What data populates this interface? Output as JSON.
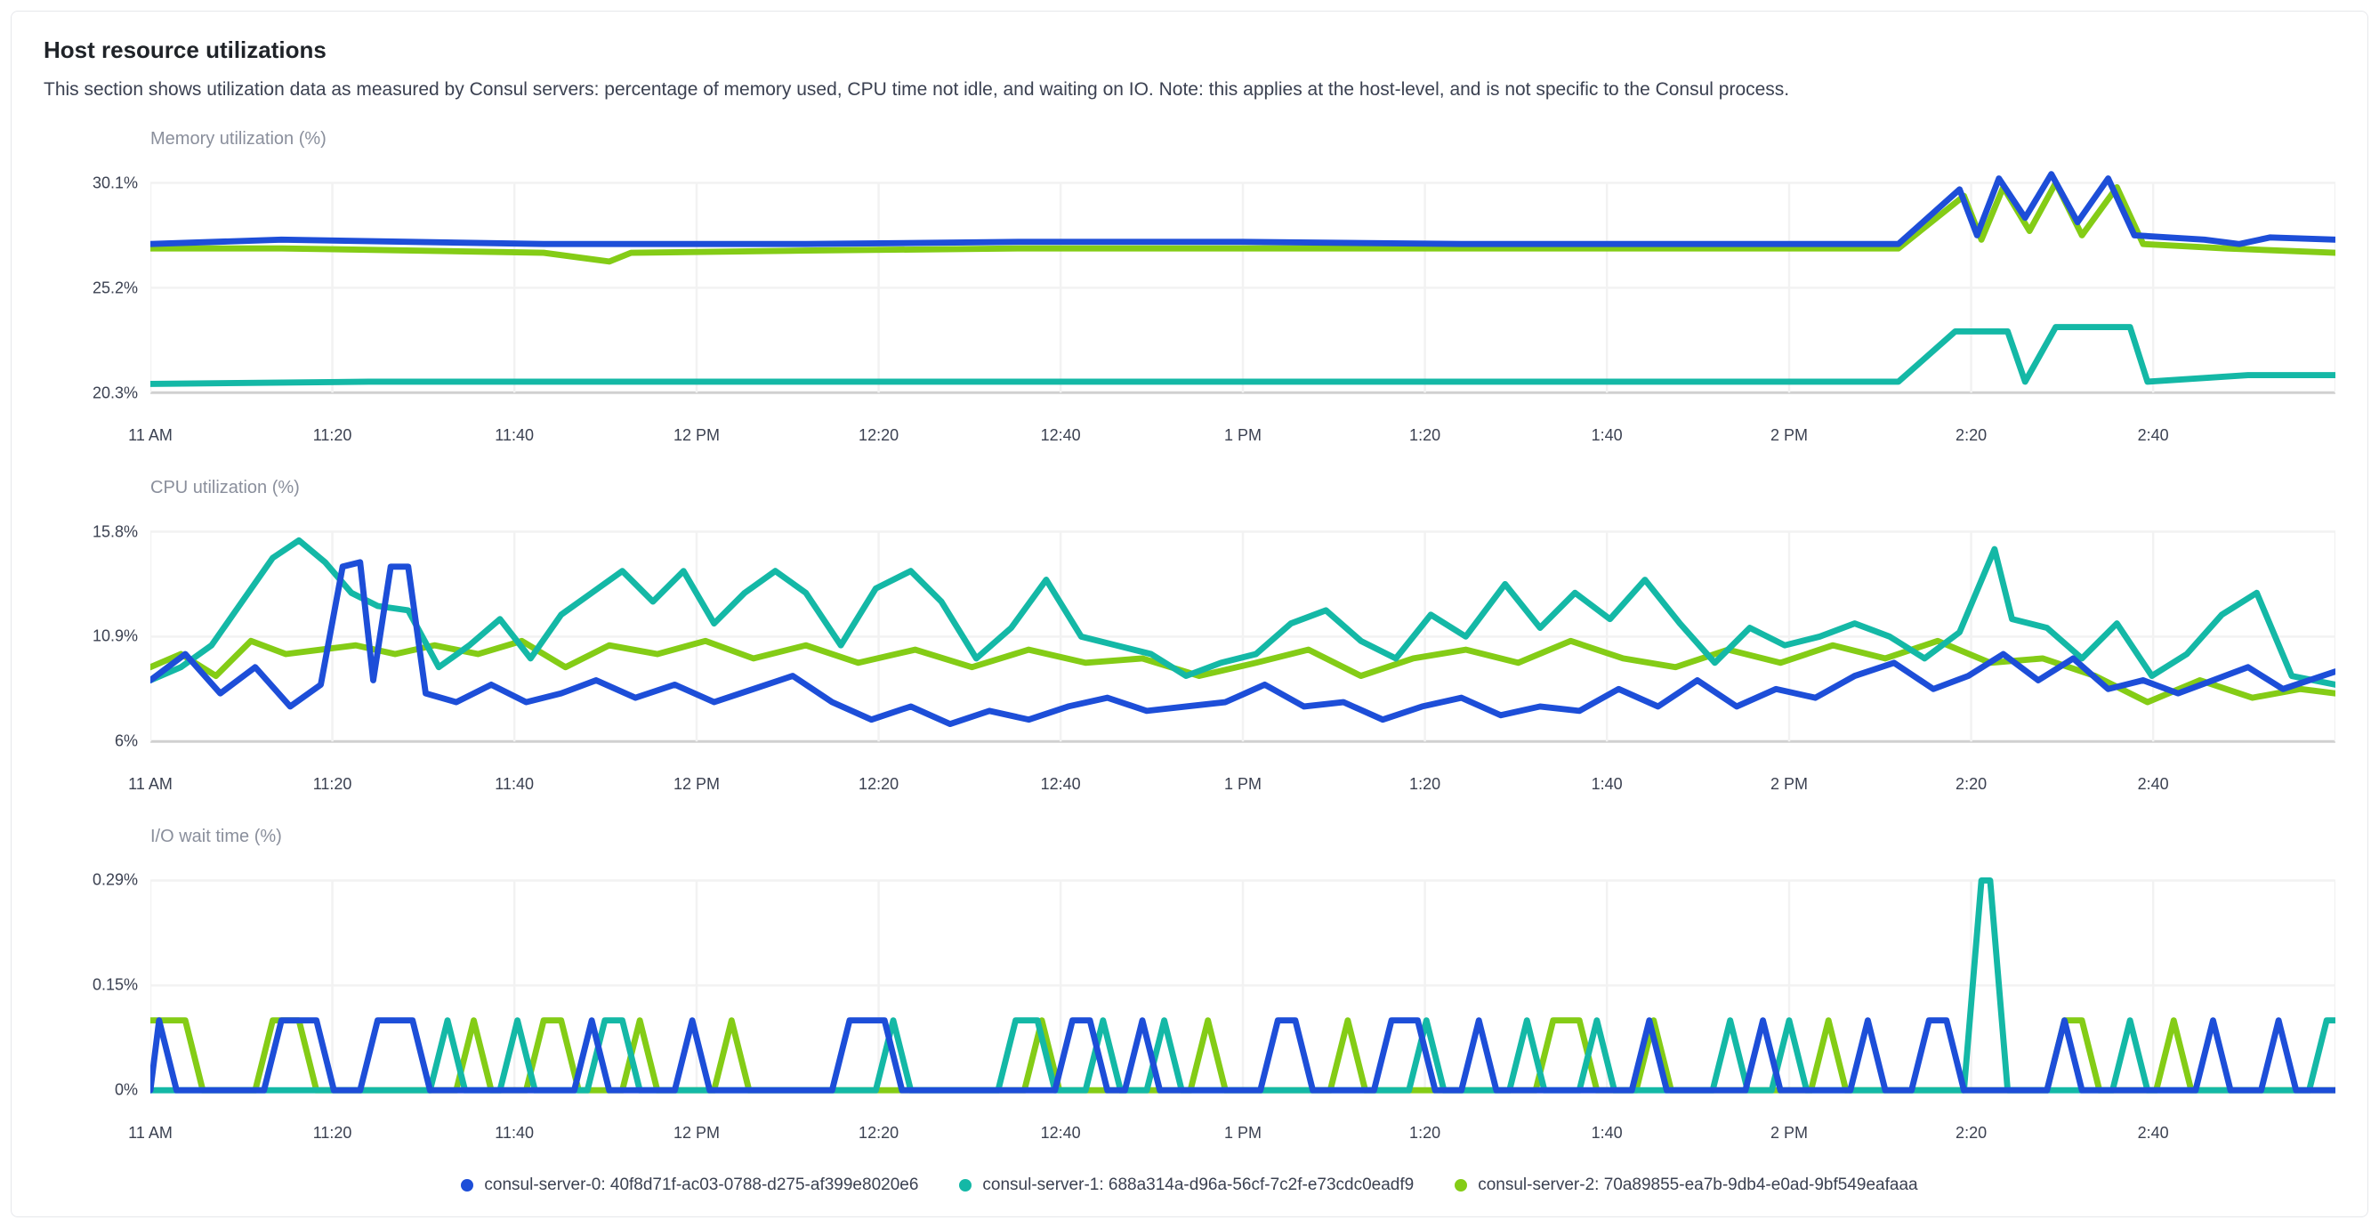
{
  "header": {
    "title": "Host resource utilizations",
    "description": "This section shows utilization data as measured by Consul servers: percentage of memory used, CPU time not idle, and waiting on IO. Note: this applies at the host-level, and is not specific to the Consul process."
  },
  "legend": {
    "items": [
      {
        "label": "consul-server-0: 40f8d71f-ac03-0788-d275-af399e8020e6",
        "color": "#1d4ed8"
      },
      {
        "label": "consul-server-1: 688a314a-d96a-56cf-7c2f-e73cdc0eadf9",
        "color": "#14b8a6"
      },
      {
        "label": "consul-server-2: 70a89855-ea7b-9db4-e0ad-9bf549eafaaa",
        "color": "#84cc16"
      }
    ]
  },
  "x_ticks": [
    "11 AM",
    "11:20",
    "11:40",
    "12 PM",
    "12:20",
    "12:40",
    "1 PM",
    "1:20",
    "1:40",
    "2 PM",
    "2:20",
    "2:40"
  ],
  "chart_data": [
    {
      "type": "line",
      "title": "Memory utilization (%)",
      "ylabel": "",
      "ylim": [
        20.3,
        30.1
      ],
      "y_ticks": [
        "30.1%",
        "25.2%",
        "20.3%"
      ],
      "categories": [
        "11 AM",
        "11:20",
        "11:40",
        "12 PM",
        "12:20",
        "12:40",
        "1 PM",
        "1:20",
        "1:40",
        "2 PM",
        "2:20",
        "2:40"
      ],
      "series": [
        {
          "name": "consul-server-0",
          "values": [
            27.2,
            27.3,
            27.2,
            27.1,
            27.2,
            27.2,
            27.3,
            27.2,
            27.2,
            27.2,
            28.8,
            27.8
          ]
        },
        {
          "name": "consul-server-1",
          "values": [
            20.4,
            20.5,
            20.5,
            20.5,
            20.5,
            20.5,
            20.5,
            20.5,
            20.5,
            20.5,
            21.9,
            20.9
          ]
        },
        {
          "name": "consul-server-2",
          "values": [
            27.0,
            27.0,
            26.9,
            26.9,
            27.0,
            27.0,
            27.0,
            27.0,
            27.0,
            27.0,
            28.2,
            27.1
          ]
        }
      ]
    },
    {
      "type": "line",
      "title": "CPU utilization (%)",
      "ylabel": "",
      "ylim": [
        4,
        15.8
      ],
      "y_ticks": [
        "15.8%",
        "10.9%",
        "6%"
      ],
      "categories": [
        "11 AM",
        "11:20",
        "11:40",
        "12 PM",
        "12:20",
        "12:40",
        "1 PM",
        "1:20",
        "1:40",
        "2 PM",
        "2:20",
        "2:40"
      ],
      "series": [
        {
          "name": "consul-server-0",
          "values": [
            8.0,
            12.0,
            7.0,
            7.2,
            7.0,
            6.5,
            7.0,
            6.5,
            6.9,
            7.4,
            8.3,
            8.2
          ]
        },
        {
          "name": "consul-server-1",
          "values": [
            9.0,
            12.5,
            10.0,
            12.0,
            12.0,
            9.5,
            9.7,
            11.0,
            12.0,
            10.0,
            12.0,
            9.0
          ]
        },
        {
          "name": "consul-server-2",
          "values": [
            9.2,
            9.5,
            9.3,
            9.7,
            9.1,
            9.0,
            9.4,
            9.3,
            9.6,
            9.1,
            8.9,
            7.8
          ]
        }
      ]
    },
    {
      "type": "line",
      "title": "I/O wait time (%)",
      "ylabel": "",
      "ylim": [
        0,
        0.29
      ],
      "y_ticks": [
        "0.29%",
        "0.15%",
        "0%"
      ],
      "categories": [
        "11 AM",
        "11:20",
        "11:40",
        "12 PM",
        "12:20",
        "12:40",
        "1 PM",
        "1:20",
        "1:40",
        "2 PM",
        "2:20",
        "2:40"
      ],
      "series": [
        {
          "name": "consul-server-0",
          "values": [
            0.1,
            0.1,
            0.1,
            0.0,
            0.1,
            0.1,
            0.1,
            0.1,
            0.1,
            0.1,
            0.1,
            0.1
          ]
        },
        {
          "name": "consul-server-1",
          "values": [
            0.0,
            0.0,
            0.1,
            0.1,
            0.1,
            0.1,
            0.0,
            0.1,
            0.1,
            0.1,
            0.28,
            0.1
          ]
        },
        {
          "name": "consul-server-2",
          "values": [
            0.1,
            0.1,
            0.1,
            0.0,
            0.1,
            0.1,
            0.1,
            0.1,
            0.1,
            0.0,
            0.1,
            0.0
          ]
        }
      ]
    }
  ]
}
